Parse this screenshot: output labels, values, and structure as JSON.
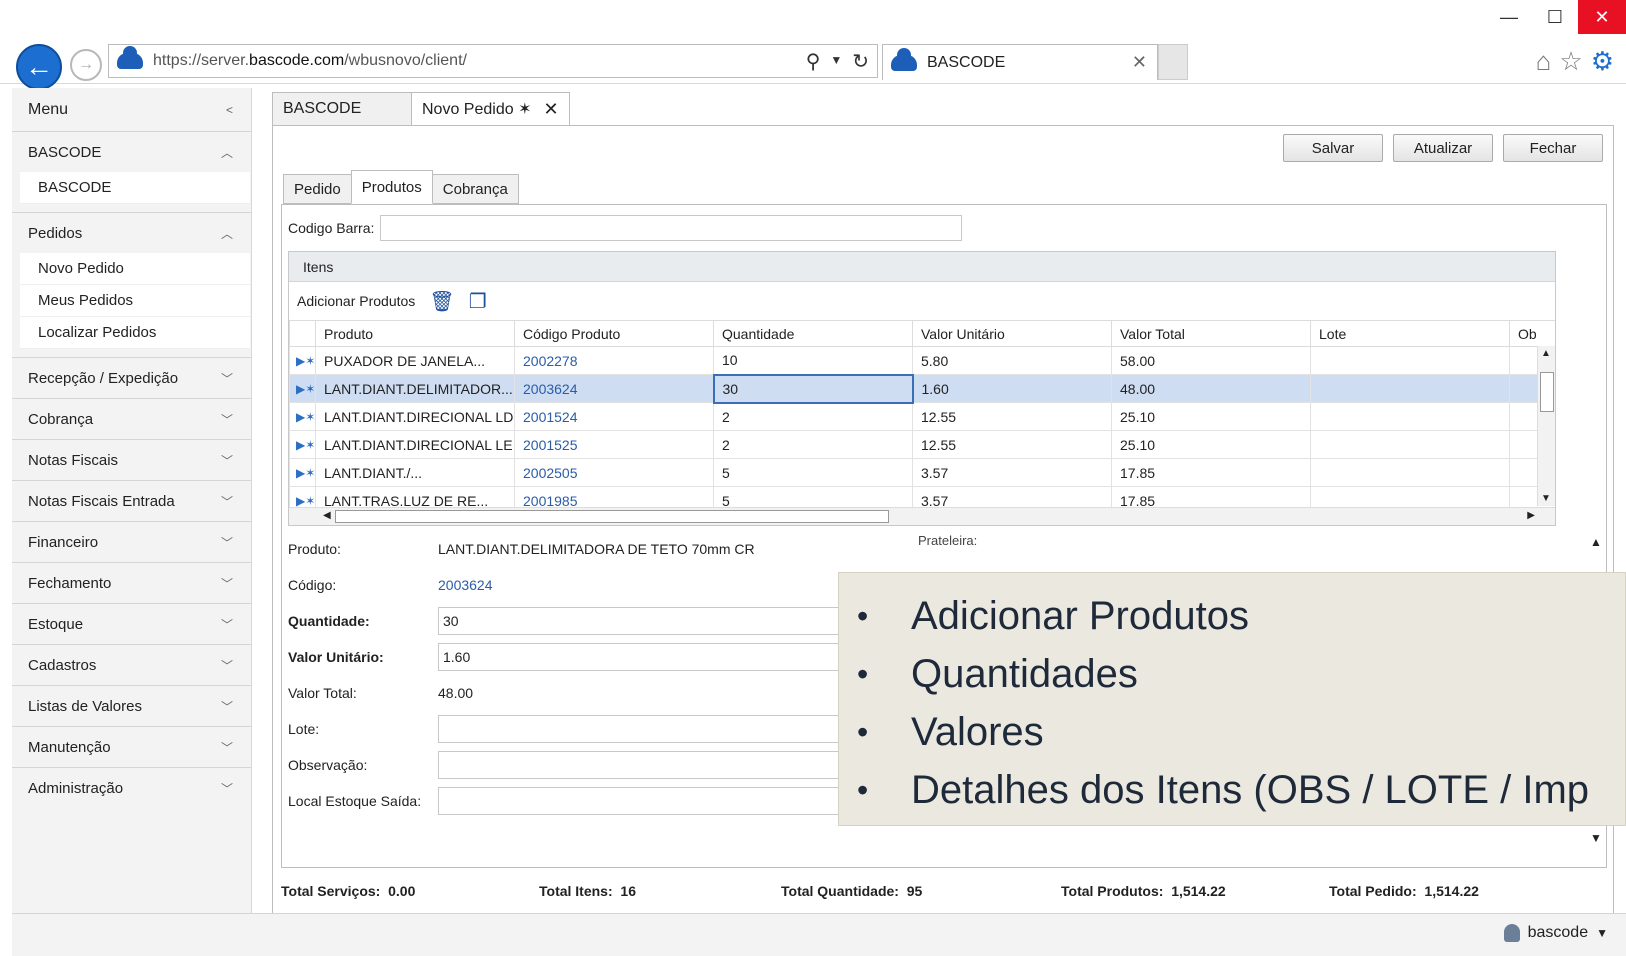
{
  "browser": {
    "url_prefix": "https://server.",
    "url_domain": "bascode.com",
    "url_path": "/wbusnovo/client/",
    "tab_title": "BASCODE"
  },
  "sidebar": {
    "menu_label": "Menu",
    "sections": [
      {
        "label": "BASCODE",
        "items": [
          "BASCODE"
        ]
      },
      {
        "label": "Pedidos",
        "items": [
          "Novo Pedido",
          "Meus Pedidos",
          "Localizar Pedidos"
        ]
      },
      {
        "label": "Recepção / Expedição"
      },
      {
        "label": "Cobrança"
      },
      {
        "label": "Notas Fiscais"
      },
      {
        "label": "Notas Fiscais Entrada"
      },
      {
        "label": "Financeiro"
      },
      {
        "label": "Fechamento"
      },
      {
        "label": "Estoque"
      },
      {
        "label": "Cadastros"
      },
      {
        "label": "Listas de Valores"
      },
      {
        "label": "Manutenção"
      },
      {
        "label": "Administração"
      }
    ]
  },
  "app_tabs": [
    {
      "label": "BASCODE"
    },
    {
      "label": "Novo Pedido ✶"
    }
  ],
  "toolbar": {
    "save": "Salvar",
    "refresh": "Atualizar",
    "close": "Fechar"
  },
  "inner_tabs": [
    "Pedido",
    "Produtos",
    "Cobrança"
  ],
  "barcode_label": "Codigo Barra:",
  "items": {
    "title": "Itens",
    "add_label": "Adicionar Produtos",
    "columns": [
      "Produto",
      "Código Produto",
      "Quantidade",
      "Valor Unitário",
      "Valor Total",
      "Lote",
      "Ob"
    ],
    "rows": [
      [
        "PUXADOR DE JANELA...",
        "2002278",
        "10",
        "5.80",
        "58.00",
        ""
      ],
      [
        "LANT.DIANT.DELIMITADOR...",
        "2003624",
        "30",
        "1.60",
        "48.00",
        ""
      ],
      [
        "LANT.DIANT.DIRECIONAL LD",
        "2001524",
        "2",
        "12.55",
        "25.10",
        ""
      ],
      [
        "LANT.DIANT.DIRECIONAL LE",
        "2001525",
        "2",
        "12.55",
        "25.10",
        ""
      ],
      [
        "LANT.DIANT./...",
        "2002505",
        "5",
        "3.57",
        "17.85",
        ""
      ],
      [
        "LANT.TRAS.LUZ DE RE...",
        "2001985",
        "5",
        "3.57",
        "17.85",
        ""
      ]
    ]
  },
  "detail": {
    "produto_label": "Produto:",
    "produto_value": "LANT.DIANT.DELIMITADORA DE TETO 70mm  CR",
    "codigo_label": "Código:",
    "codigo_value": "2003624",
    "quantidade_label": "Quantidade:",
    "quantidade_value": "30",
    "valor_unit_label": "Valor Unitário:",
    "valor_unit_value": "1.60",
    "valor_total_label": "Valor Total:",
    "valor_total_value": "48.00",
    "lote_label": "Lote:",
    "obs_label": "Observação:",
    "local_label": "Local Estoque Saída:",
    "prateleira_label": "Prateleira:"
  },
  "totals": {
    "servicos_label": "Total Serviços:",
    "servicos_value": "0.00",
    "itens_label": "Total Itens:",
    "itens_value": "16",
    "quantidade_label": "Total Quantidade:",
    "quantidade_value": "95",
    "produtos_label": "Total Produtos:",
    "produtos_value": "1,514.22",
    "pedido_label": "Total Pedido:",
    "pedido_value": "1,514.22"
  },
  "overlay": {
    "bullets": [
      "Adicionar Produtos",
      "Quantidades",
      "Valores",
      "Detalhes dos Itens (OBS / LOTE / Imp"
    ]
  },
  "footer": {
    "user": "bascode"
  }
}
